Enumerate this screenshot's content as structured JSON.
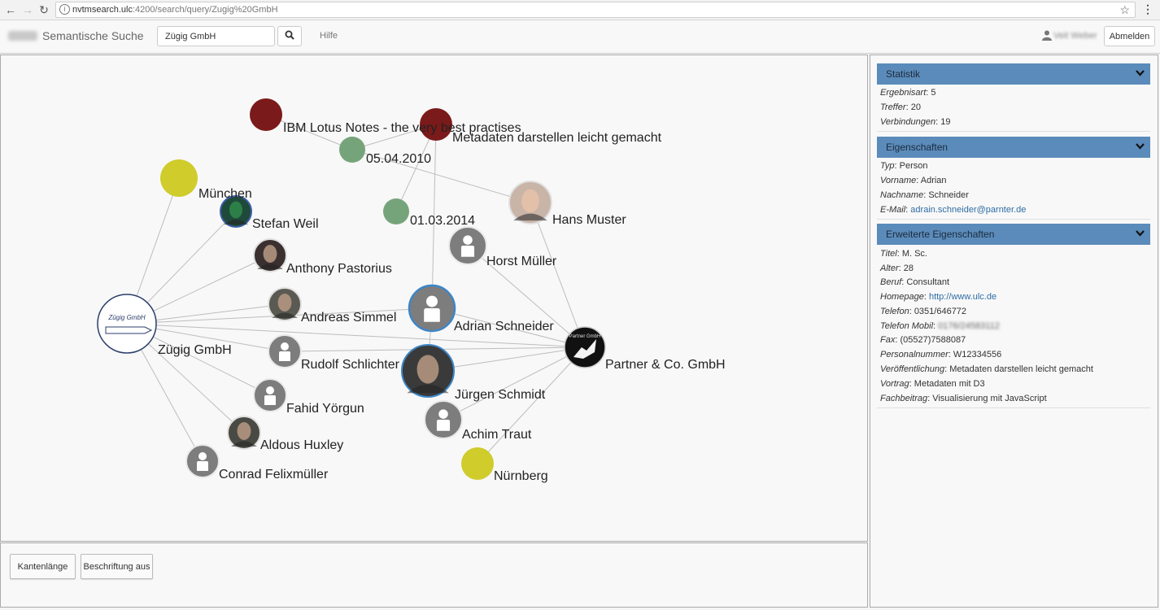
{
  "browser": {
    "url_host": "nvtmsearch.ulc",
    "url_rest": ":4200/search/query/Zugig%20GmbH"
  },
  "header": {
    "brand": "Semantische Suche",
    "search_value": "Zügig GmbH",
    "help": "Hilfe",
    "user": "Veit Weber",
    "logout": "Abmelden"
  },
  "controls": {
    "edge_length": "Kantenlänge",
    "labels_off": "Beschriftung aus"
  },
  "graph": {
    "nodes": [
      {
        "id": "lotus",
        "label": "IBM Lotus Notes - the very best practises",
        "kind": "doc",
        "color": "#7b1a1a"
      },
      {
        "id": "meta",
        "label": "Metadaten darstellen leicht gemacht",
        "kind": "doc",
        "color": "#7b1a1a"
      },
      {
        "id": "d2010",
        "label": "05.04.2010",
        "kind": "date",
        "color": "#76a47a"
      },
      {
        "id": "d2014",
        "label": "01.03.2014",
        "kind": "date",
        "color": "#76a47a"
      },
      {
        "id": "muenchen",
        "label": "München",
        "kind": "place",
        "color": "#cfcc2c"
      },
      {
        "id": "nuernberg",
        "label": "Nürnberg",
        "kind": "place",
        "color": "#cfcc2c"
      },
      {
        "id": "stefan",
        "label": "Stefan Weil",
        "kind": "photo",
        "color": "#1f4a3a"
      },
      {
        "id": "anthony",
        "label": "Anthony Pastorius",
        "kind": "photo",
        "color": "#3a3030"
      },
      {
        "id": "andreas",
        "label": "Andreas Simmel",
        "kind": "photo",
        "color": "#5a5a52"
      },
      {
        "id": "rudolf",
        "label": "Rudolf Schlichter",
        "kind": "person",
        "color": "#7d7d7d"
      },
      {
        "id": "fahid",
        "label": "Fahid Yörgun",
        "kind": "person",
        "color": "#7d7d7d"
      },
      {
        "id": "aldous",
        "label": "Aldous Huxley",
        "kind": "photo",
        "color": "#4a4a44"
      },
      {
        "id": "conrad",
        "label": "Conrad Felixmüller",
        "kind": "person",
        "color": "#7d7d7d"
      },
      {
        "id": "horst",
        "label": "Horst Müller",
        "kind": "person",
        "color": "#7d7d7d"
      },
      {
        "id": "adrian",
        "label": "Adrian Schneider",
        "kind": "person",
        "color": "#7d7d7d"
      },
      {
        "id": "juergen",
        "label": "Jürgen Schmidt",
        "kind": "photo",
        "color": "#3a3a3a"
      },
      {
        "id": "achim",
        "label": "Achim Traut",
        "kind": "person",
        "color": "#7d7d7d"
      },
      {
        "id": "hans",
        "label": "Hans Muster",
        "kind": "photo",
        "color": "#c9b4a8"
      },
      {
        "id": "zuegig",
        "label": "Zügig GmbH",
        "kind": "company",
        "color": "#ffffff",
        "logo_text": "Zügig GmbH"
      },
      {
        "id": "partner",
        "label": "Partner & Co. GmbH",
        "kind": "company",
        "color": "#111111",
        "logo_text": "Partner GmbH"
      }
    ],
    "edges": [
      [
        "lotus",
        "d2010"
      ],
      [
        "meta",
        "d2010"
      ],
      [
        "d2010",
        "hans"
      ],
      [
        "meta",
        "d2014"
      ],
      [
        "meta",
        "adrian"
      ],
      [
        "zuegig",
        "muenchen"
      ],
      [
        "zuegig",
        "stefan"
      ],
      [
        "zuegig",
        "anthony"
      ],
      [
        "zuegig",
        "andreas"
      ],
      [
        "zuegig",
        "rudolf"
      ],
      [
        "zuegig",
        "fahid"
      ],
      [
        "zuegig",
        "aldous"
      ],
      [
        "zuegig",
        "conrad"
      ],
      [
        "zuegig",
        "adrian"
      ],
      [
        "zuegig",
        "partner"
      ],
      [
        "partner",
        "hans"
      ],
      [
        "partner",
        "horst"
      ],
      [
        "partner",
        "adrian"
      ],
      [
        "partner",
        "juergen"
      ],
      [
        "partner",
        "rudolf"
      ],
      [
        "partner",
        "achim"
      ],
      [
        "partner",
        "nuernberg"
      ],
      [
        "adrian",
        "juergen"
      ]
    ]
  },
  "sidebar": {
    "sections": [
      {
        "title": "Statistik",
        "rows": [
          {
            "key": "Ergebnisart",
            "value": "5"
          },
          {
            "key": "Treffer",
            "value": "20"
          },
          {
            "key": "Verbindungen",
            "value": "19"
          }
        ]
      },
      {
        "title": "Eigenschaften",
        "rows": [
          {
            "key": "Typ",
            "value": "Person"
          },
          {
            "key": "Vorname",
            "value": "Adrian"
          },
          {
            "key": "Nachname",
            "value": "Schneider"
          },
          {
            "key": "E-Mail",
            "value": "adrain.schneider@parnter.de",
            "link": true
          }
        ]
      },
      {
        "title": "Erweiterte Eigenschaften",
        "rows": [
          {
            "key": "Titel",
            "value": "M. Sc."
          },
          {
            "key": "Alter",
            "value": "28"
          },
          {
            "key": "Beruf",
            "value": "Consultant"
          },
          {
            "key": "Homepage",
            "value": "http://www.ulc.de",
            "link": true
          },
          {
            "key": "Telefon",
            "value": "0351/646772"
          },
          {
            "key": "Telefon Mobil",
            "value": "0176/24583112",
            "blurred": true
          },
          {
            "key": "Fax",
            "value": "(05527)7588087"
          },
          {
            "key": "Personalnummer",
            "value": "W12334556"
          },
          {
            "key": "Veröffentlichung",
            "value": "Metadaten darstellen leicht gemacht"
          },
          {
            "key": "Vortrag",
            "value": "Metadaten mit D3"
          },
          {
            "key": "Fachbeitrag",
            "value": "Visualisierung mit JavaScript"
          }
        ]
      }
    ]
  }
}
